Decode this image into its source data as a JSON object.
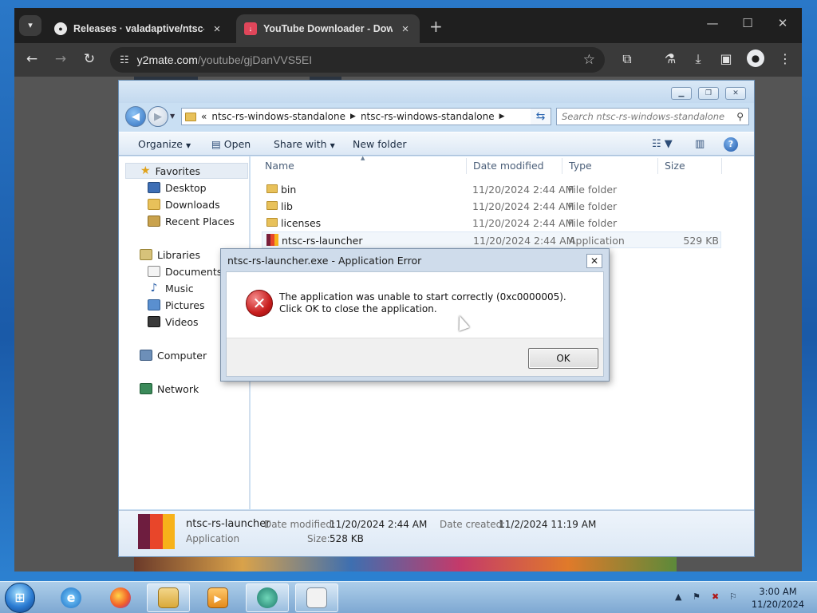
{
  "browser": {
    "tabs": [
      {
        "title": "Releases · valadaptive/ntsc-rs",
        "active": false
      },
      {
        "title": "YouTube Downloader - Downl",
        "active": true
      }
    ],
    "address": {
      "host": "y2mate.com",
      "path": "/youtube/gjDanVVS5EI"
    }
  },
  "explorer": {
    "breadcrumb": {
      "overflow": "«",
      "parts": [
        "ntsc-rs-windows-standalone",
        "ntsc-rs-windows-standalone"
      ]
    },
    "search_placeholder": "Search ntsc-rs-windows-standalone",
    "commands": {
      "organize": "Organize",
      "open": "Open",
      "share": "Share with",
      "new_folder": "New folder"
    },
    "nav": {
      "favorites": "Favorites",
      "favorites_items": [
        "Desktop",
        "Downloads",
        "Recent Places"
      ],
      "libraries": "Libraries",
      "libraries_items": [
        "Documents",
        "Music",
        "Pictures",
        "Videos"
      ],
      "computer": "Computer",
      "network": "Network"
    },
    "columns": {
      "name": "Name",
      "date": "Date modified",
      "type": "Type",
      "size": "Size"
    },
    "files": [
      {
        "name": "bin",
        "date": "11/20/2024 2:44 AM",
        "type": "File folder",
        "size": "",
        "kind": "folder"
      },
      {
        "name": "lib",
        "date": "11/20/2024 2:44 AM",
        "type": "File folder",
        "size": "",
        "kind": "folder"
      },
      {
        "name": "licenses",
        "date": "11/20/2024 2:44 AM",
        "type": "File folder",
        "size": "",
        "kind": "folder"
      },
      {
        "name": "ntsc-rs-launcher",
        "date": "11/20/2024 2:44 AM",
        "type": "Application",
        "size": "529 KB",
        "kind": "app"
      }
    ],
    "details": {
      "name": "ntsc-rs-launcher",
      "kind": "Application",
      "modified_label": "Date modified:",
      "modified_value": "11/20/2024 2:44 AM",
      "created_label": "Date created:",
      "created_value": "11/2/2024 11:19 AM",
      "size_label": "Size:",
      "size_value": "528 KB"
    }
  },
  "dialog": {
    "title": "ntsc-rs-launcher.exe - Application Error",
    "message": "The application was unable to start correctly (0xc0000005). Click OK to close the application.",
    "ok": "OK",
    "close": "✕"
  },
  "taskbar": {
    "time": "3:00 AM",
    "date": "11/20/2024"
  },
  "colors": {
    "chrome_dark": "#1f1f1f",
    "explorer_frame": "#c9dff3",
    "error_red": "#c81e1e"
  }
}
